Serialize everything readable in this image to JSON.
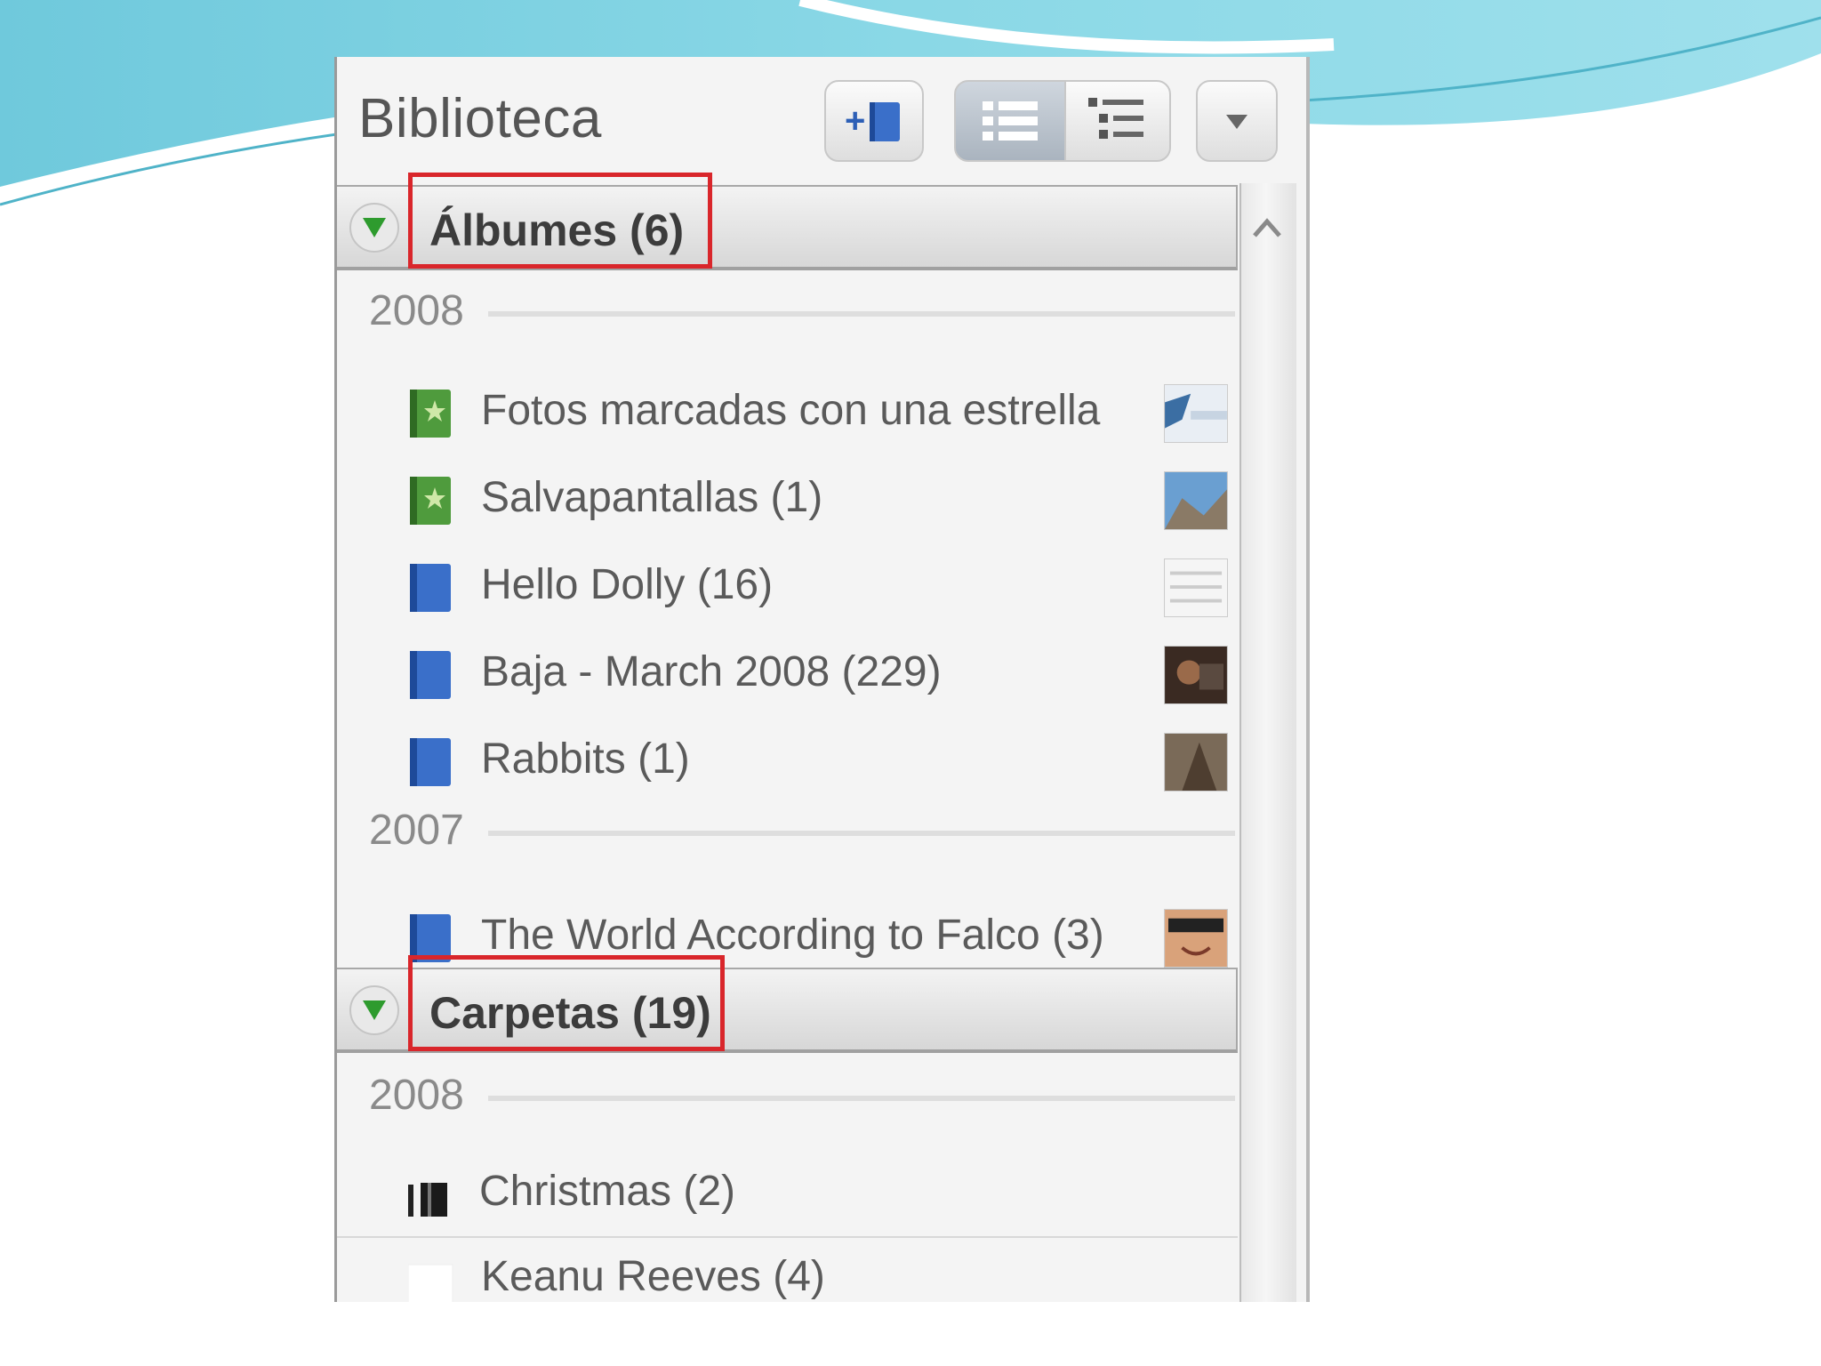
{
  "panel": {
    "title": "Biblioteca",
    "toolbar": {
      "add_icon": "add-album-icon",
      "list_icon": "list-view-icon",
      "tree_icon": "tree-view-icon",
      "menu_icon": "chevron-down-icon"
    }
  },
  "albums": {
    "header": "Álbumes (6)",
    "years": [
      "2008",
      "2007"
    ],
    "items": [
      {
        "label": "Fotos marcadas con una estrella",
        "icon": "starred-album-icon"
      },
      {
        "label": "Salvapantallas (1)",
        "icon": "starred-album-icon"
      },
      {
        "label": "Hello Dolly (16)",
        "icon": "album-icon"
      },
      {
        "label": "Baja - March 2008 (229)",
        "icon": "album-icon"
      },
      {
        "label": "Rabbits (1)",
        "icon": "album-icon"
      },
      {
        "label": "The World According to Falco (3)",
        "icon": "album-icon"
      }
    ]
  },
  "folders": {
    "header": "Carpetas (19)",
    "year": "2008",
    "items": [
      {
        "label": "Christmas (2)",
        "icon": "folder-icon"
      },
      {
        "label": "Keanu Reeves (4)",
        "icon": "folder-icon"
      }
    ]
  },
  "colors": {
    "highlight": "#d9262b",
    "toggle": "#2e9b2e",
    "album_blue": "#3a6fc9",
    "starred_green": "#3d8a2f"
  }
}
